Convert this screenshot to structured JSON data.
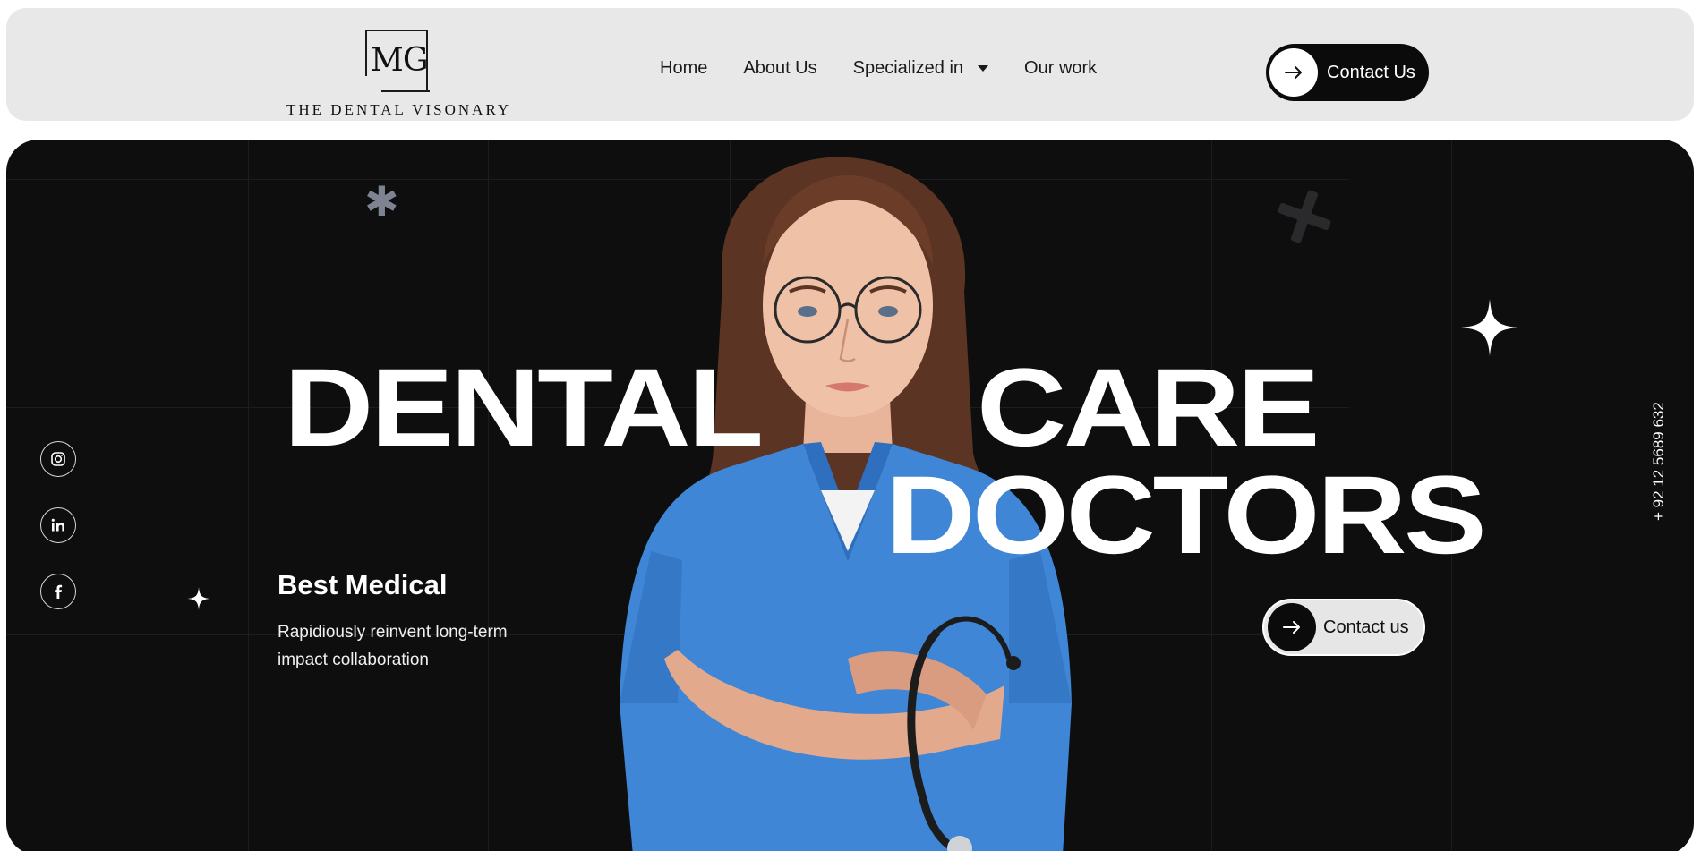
{
  "header": {
    "logo_mark": "MG",
    "logo_text": "THE DENTAL VISONARY",
    "nav": [
      {
        "label": "Home"
      },
      {
        "label": "About Us"
      },
      {
        "label": "Specialized in"
      },
      {
        "label": "Our work"
      }
    ],
    "cta_label": "Contact Us"
  },
  "hero": {
    "headline_word1": "DENTAL",
    "headline_word2": "CARE",
    "headline_word3": "DOCTORS",
    "subtitle": "Best Medical",
    "description": "Rapidiously reinvent long-term impact collaboration",
    "cta_label": "Contact us",
    "phone": "+ 92 12 5689 632",
    "social_icons": [
      "instagram-icon",
      "linkedin-icon",
      "facebook-icon"
    ]
  },
  "colors": {
    "hero_bg": "#0e0e0f",
    "header_bg": "#e8e8e8",
    "scrubs_blue": "#3f86d6"
  }
}
